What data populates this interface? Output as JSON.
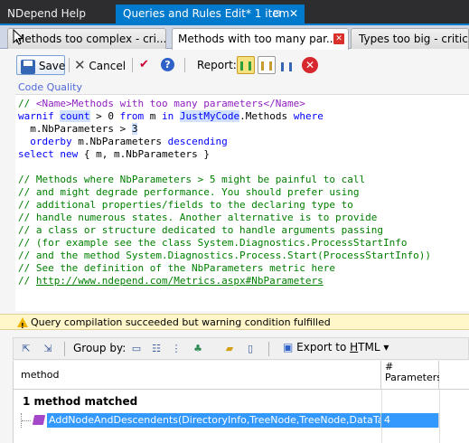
{
  "window_tabs": [
    {
      "label": "NDepend Help"
    },
    {
      "label": "Queries and Rules Edit* 1 item",
      "pin": "⊡",
      "close": "✕"
    }
  ],
  "query_tabs": [
    {
      "label": "Methods too complex - cri..."
    },
    {
      "label": "Methods with too many par...*",
      "close": "✕"
    },
    {
      "label": "Types too big - critical"
    }
  ],
  "toolbar": {
    "save_label": "Save",
    "cancel_label": "Cancel",
    "report_label": "Report:"
  },
  "section_label": "Code Quality",
  "code": {
    "line1_a": "// ",
    "line1_tag": "<Name>Methods with too many parameters</Name>",
    "l2_warnif": "warnif",
    "l2_count": "count",
    "l2_gt": " > ",
    "l2_zero": "0",
    "l2_from": " from",
    "l2_m": " m ",
    "l2_in": "in",
    "l2_sp": " ",
    "l2_jmc": "JustMyCode",
    "l2_methods": ".Methods ",
    "l2_where": "where",
    "l3": "  m.NbParameters > ",
    "l3_num": "3",
    "l4_orderby": "  orderby",
    "l4_rest": " m.NbParameters ",
    "l4_desc": "descending",
    "l5_select": "select",
    "l5_sp": " ",
    "l5_new": "new",
    "l5_rest": " { m, m.NbParameters }",
    "comments": [
      "// Methods where NbParameters > 5 might be painful to call",
      "// and might degrade performance. You should prefer using",
      "// additional properties/fields to the declaring type to",
      "// handle numerous states. Another alternative is to provide",
      "// a class or structure dedicated to handle arguments passing",
      "// (for example see the class System.Diagnostics.ProcessStartInfo",
      "// and the method System.Diagnostics.Process.Start(ProcessStartInfo))",
      "// See the definition of the NbParameters metric here"
    ],
    "link_prefix": "// ",
    "link": "http://www.ndepend.com/Metrics.aspx#NbParameters"
  },
  "status": {
    "message": "Query compilation succeeded but warning condition fulfilled",
    "color": "#fff6c9"
  },
  "results_toolbar": {
    "group_by_label": "Group by:",
    "export_prefix": "Export to ",
    "export_u": "H",
    "export_suffix": "TML",
    "export_arrow": "▾"
  },
  "results": {
    "columns": [
      "method",
      "# Parameters"
    ],
    "col2_line1": "#",
    "col2_line2": "Parameters",
    "summary": "1 method matched",
    "rows": [
      {
        "method": "AddNodeAndDescendents(DirectoryInfo,TreeNode,TreeNode,DataTable)",
        "parameters": "4"
      }
    ]
  },
  "colors": {
    "accent": "#007acc",
    "selection": "#3399ff",
    "keyword": "#0000ff",
    "comment": "#008000"
  }
}
